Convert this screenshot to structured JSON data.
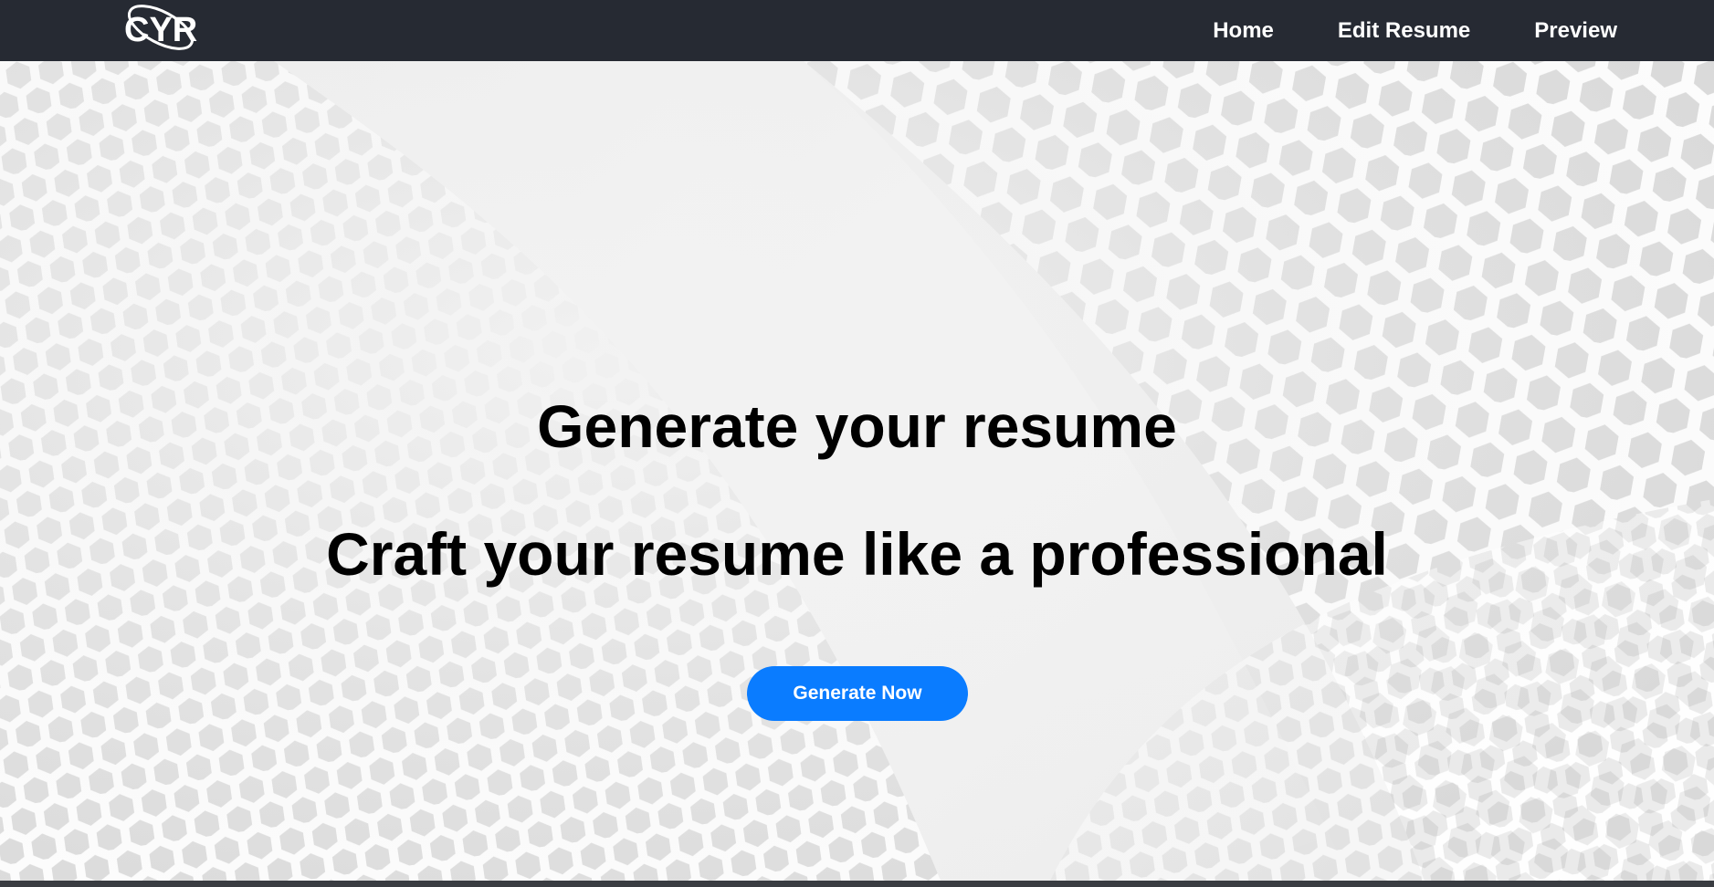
{
  "navbar": {
    "logo_text": "CYR",
    "links": [
      {
        "label": "Home"
      },
      {
        "label": "Edit Resume"
      },
      {
        "label": "Preview"
      }
    ]
  },
  "hero": {
    "headline": "Generate your resume",
    "subheadline": "Craft your resume like a professional",
    "cta_label": "Generate Now",
    "background_pattern": "hexagon-mesh"
  },
  "colors": {
    "navbar_bg": "#262a33",
    "cta_bg": "#0a7cff",
    "heading_text": "#000000",
    "nav_text": "#ffffff"
  }
}
